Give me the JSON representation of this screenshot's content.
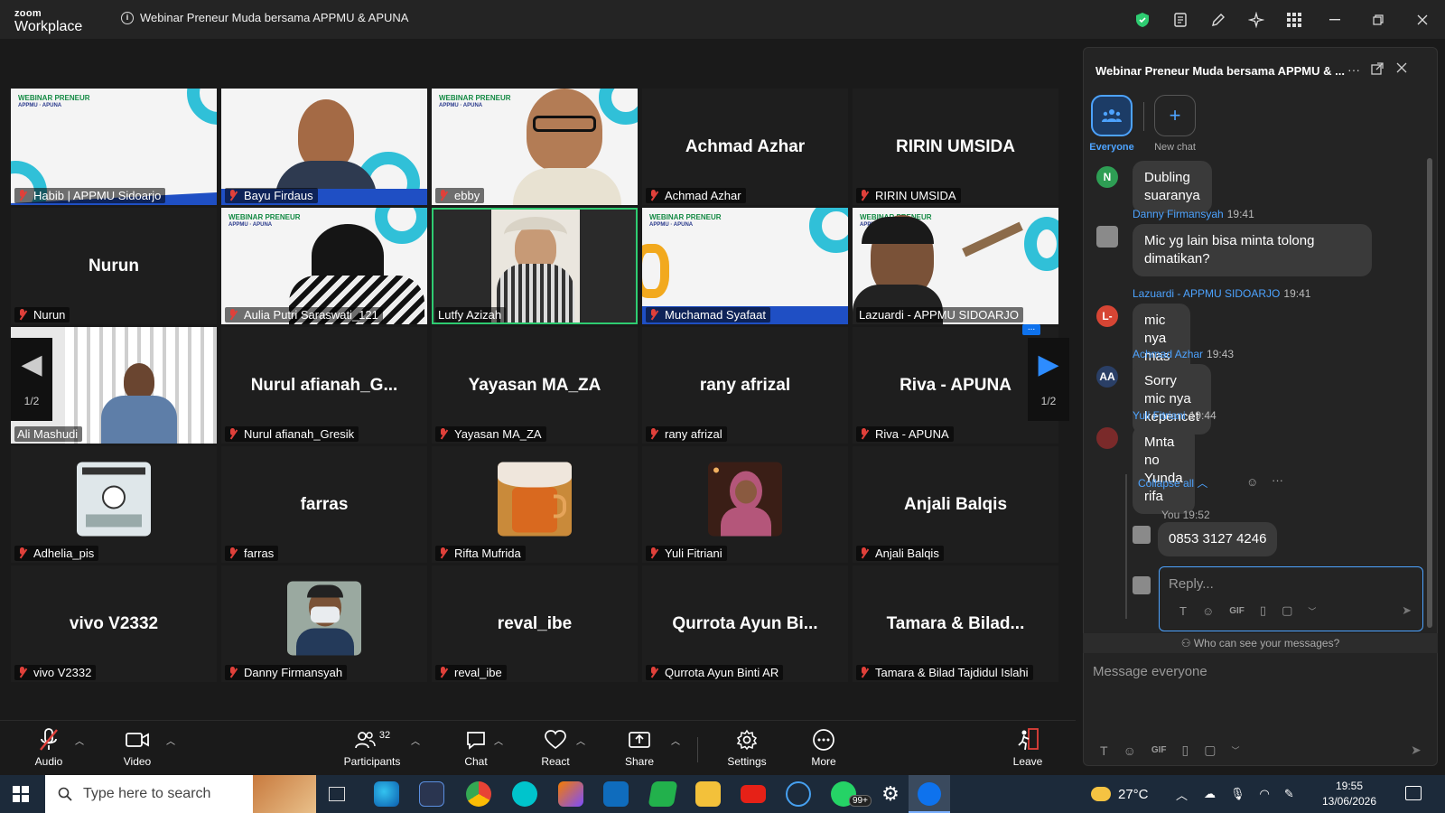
{
  "app": {
    "logo_top": "zoom",
    "logo_bottom": "Workplace",
    "meeting_title": "Webinar Preneur Muda bersama APPMU & APUNA"
  },
  "tiles": [
    {
      "label": "Habib | APPMU Sidoarjo",
      "center": ""
    },
    {
      "label": "Bayu Firdaus",
      "center": ""
    },
    {
      "label": "ebby",
      "center": ""
    },
    {
      "label": "Achmad Azhar",
      "center": "Achmad Azhar"
    },
    {
      "label": "RIRIN UMSIDA",
      "center": "RIRIN UMSIDA"
    },
    {
      "label": "Nurun",
      "center": "Nurun"
    },
    {
      "label": "Aulia Putri Saraswati_121",
      "center": ""
    },
    {
      "label": "Lutfy Azizah",
      "center": ""
    },
    {
      "label": "Muchamad Syafaat",
      "center": ""
    },
    {
      "label": "Lazuardi - APPMU SIDOARJO",
      "center": ""
    },
    {
      "label": "Ali Mashudi",
      "center": ""
    },
    {
      "label": "Nurul afianah_Gresik",
      "center": "Nurul afianah_G..."
    },
    {
      "label": "Yayasan MA_ZA",
      "center": "Yayasan MA_ZA"
    },
    {
      "label": "rany afrizal",
      "center": "rany afrizal"
    },
    {
      "label": "Riva - APUNA",
      "center": "Riva - APUNA"
    },
    {
      "label": "Adhelia_pis",
      "center": ""
    },
    {
      "label": "farras",
      "center": "farras"
    },
    {
      "label": "Rifta Mufrida",
      "center": ""
    },
    {
      "label": "Yuli Fitriani",
      "center": ""
    },
    {
      "label": "Anjali Balqis",
      "center": "Anjali Balqis"
    },
    {
      "label": "vivo V2332",
      "center": "vivo V2332"
    },
    {
      "label": "Danny Firmansyah",
      "center": ""
    },
    {
      "label": "reval_ibe",
      "center": "reval_ibe"
    },
    {
      "label": "Qurrota Ayun Binti AR",
      "center": "Qurrota Ayun Bi..."
    },
    {
      "label": "Tamara & Bilad Tajdidul Islahi",
      "center": "Tamara & Bilad..."
    }
  ],
  "pager": {
    "left": "1/2",
    "right": "1/2",
    "more": "..."
  },
  "toolbar": {
    "audio": "Audio",
    "video": "Video",
    "participants": "Participants",
    "participants_count": "32",
    "chat": "Chat",
    "react": "React",
    "share": "Share",
    "settings": "Settings",
    "more": "More",
    "leave": "Leave"
  },
  "chat": {
    "title": "Webinar Preneur Muda bersama APPMU & ...",
    "tab_everyone": "Everyone",
    "tab_new": "New chat",
    "messages": [
      {
        "avatar": "N",
        "avatar_color": "#2e9e54",
        "sender": "",
        "time": "",
        "text": "Dubling suaranya"
      },
      {
        "avatar": "",
        "avatar_color": "#8a8a8a",
        "sender": "Danny Firmansyah",
        "time": "19:41",
        "text": "Mic yg lain bisa minta tolong dimatikan?"
      },
      {
        "avatar": "L-",
        "avatar_color": "#d64534",
        "sender": "Lazuardi - APPMU SIDOARJO",
        "time": "19:41",
        "text": "mic nya mas azhar"
      },
      {
        "avatar": "AA",
        "avatar_color": "#2a3f66",
        "sender": "Achmad Azhar",
        "time": "19:43",
        "text": "Sorry mic nya kepencet"
      },
      {
        "avatar": "",
        "avatar_color": "#7a2a2a",
        "sender": "Yuli Fitriani",
        "time": "19:44",
        "text": "Mnta no Yunda rifa"
      }
    ],
    "collapse_all": "Collapse all",
    "reply": {
      "sender": "You",
      "time": "19:52",
      "text": "0853 3127 4246"
    },
    "reply_placeholder": "Reply...",
    "who_can_see": "Who can see your messages?",
    "compose_placeholder": "Message everyone",
    "fmt_gif": "GIF"
  },
  "taskbar": {
    "search_placeholder": "Type here to search",
    "weather": "27°C",
    "time": "19:55",
    "date": "13/06/2026",
    "badge": "99+"
  }
}
